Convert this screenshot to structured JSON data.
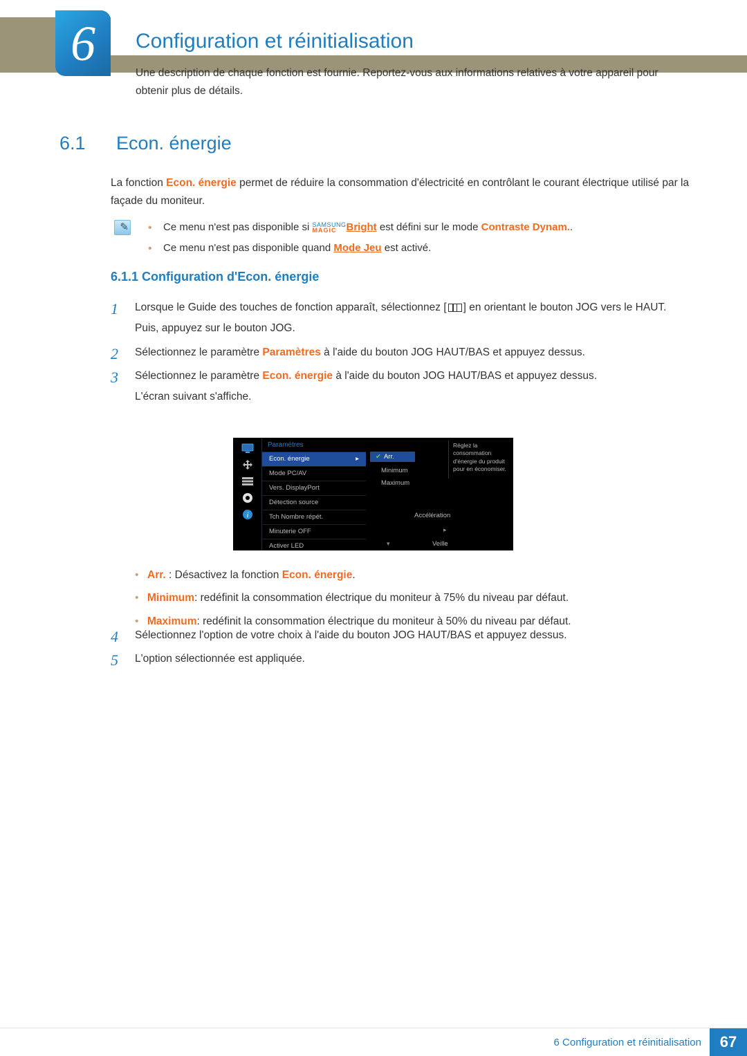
{
  "chapter": {
    "number": "6",
    "title": "Configuration et réinitialisation",
    "description": "Une description de chaque fonction est fournie. Reportez-vous aux informations relatives à votre appareil pour obtenir plus de détails."
  },
  "section_6_1": {
    "number": "6.1",
    "title": "Econ. énergie",
    "intro_pre": "La fonction ",
    "intro_bold": "Econ. énergie",
    "intro_post": " permet de réduire la consommation d'électricité en contrôlant le courant électrique utilisé par la façade du moniteur."
  },
  "notes": {
    "note1_pre": "Ce menu n'est pas disponible si ",
    "note1_magic_top": "SAMSUNG",
    "note1_magic_bot": "MAGIC",
    "note1_bright": "Bright",
    "note1_mid": " est défini sur le mode ",
    "note1_bold": "Contraste Dynam.",
    "note1_post": ".",
    "note2_pre": "Ce menu n'est pas disponible quand ",
    "note2_bold": "Mode Jeu",
    "note2_post": " est activé."
  },
  "subsection_6_1_1": {
    "label": "6.1.1   Configuration d'Econ. énergie"
  },
  "steps": {
    "s1a": "Lorsque le Guide des touches de fonction apparaît, sélectionnez [",
    "s1b": "] en orientant le bouton JOG vers le HAUT.",
    "s1c": "Puis, appuyez sur le bouton JOG.",
    "s2a": "Sélectionnez le paramètre ",
    "s2b": "Paramètres",
    "s2c": " à l'aide du bouton JOG HAUT/BAS et appuyez dessus.",
    "s3a": "Sélectionnez le paramètre ",
    "s3b": "Econ. énergie",
    "s3c": " à l'aide du bouton JOG HAUT/BAS et appuyez dessus.",
    "s3d": "L'écran suivant s'affiche.",
    "s4": "Sélectionnez l'option de votre choix à l'aide du bouton JOG HAUT/BAS et appuyez dessus.",
    "s5": "L'option sélectionnée est appliquée."
  },
  "osd": {
    "header": "Paramètres",
    "items": [
      "Econ. énergie",
      "Mode PC/AV",
      "Vers. DisplayPort",
      "Détection source",
      "Tch Nombre répét.",
      "Minuterie OFF",
      "Activer LED"
    ],
    "options": [
      "Arr.",
      "Minimum",
      "Maximum"
    ],
    "right_vals": {
      "accel": "Accélération",
      "standby": "Veille"
    },
    "desc": "Réglez la consommation d'énergie du produit pour en économiser."
  },
  "options_desc": {
    "o1a": "Arr.",
    "o1b": " : Désactivez la fonction ",
    "o1c": "Econ. énergie",
    "o1d": ".",
    "o2a": "Minimum",
    "o2b": ": redéfinit la consommation électrique du moniteur à 75% du niveau par défaut.",
    "o3a": "Maximum",
    "o3b": ": redéfinit la consommation électrique du moniteur à 50% du niveau par défaut."
  },
  "footer": {
    "text": "6 Configuration et réinitialisation",
    "page": "67"
  }
}
